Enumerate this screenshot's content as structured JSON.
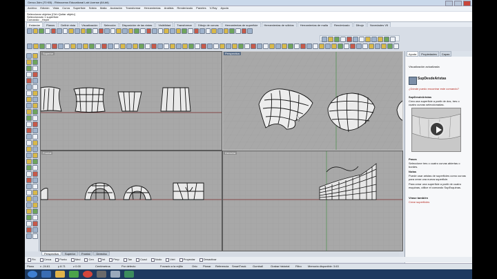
{
  "window": {
    "title": "Genco.3dm (70 KB) - Rhinoceros Educational Lab License (64-bit)"
  },
  "menu": {
    "items": [
      "Archivo",
      "Edición",
      "Vista",
      "Curva",
      "Superficie",
      "Sólido",
      "Malla",
      "Acotación",
      "Transformar",
      "Herramientas",
      "Análisis",
      "Renderizado",
      "Paneles",
      "V-Ray",
      "Ayuda"
    ]
  },
  "command": {
    "history1": "Seleccionar objetos [Ctrl=Quitar objeto]",
    "history2": "Seleccionado 1 superficie",
    "prompt": "Comando: _Hepirl"
  },
  "toolbar_tabs": [
    "Estándar",
    "Planos",
    "Definir vista",
    "Visualización",
    "Selección",
    "Disposición de las vistas",
    "Visibilidad",
    "Transformar",
    "Dibujo de curvas",
    "Herramientas de superficie",
    "Herramientas de sólidos",
    "Herramientas de malla",
    "Renderizado",
    "Dibujo",
    "Novedades V5"
  ],
  "viewports": [
    {
      "label": "Superior"
    },
    {
      "label": "Perspectiva"
    },
    {
      "label": "Frontal"
    },
    {
      "label": "Derecha"
    }
  ],
  "viewport_tabs": [
    "Perspectiva",
    "Superior",
    "Frontal",
    "Derecha"
  ],
  "osnaps": [
    "Fin",
    "Cerca",
    "Punto",
    "Med",
    "Cen",
    "Int",
    "Perp",
    "Tan",
    "Cuad",
    "Nodo",
    "Vért",
    "Proyectar",
    "Desactivar"
  ],
  "status": {
    "plane": "Plano",
    "x": "x -24.61",
    "y": "y 8.71",
    "z": "z 0.00",
    "units": "Centímetros",
    "layer": "Por defecto",
    "items": [
      "Forzado a la rejilla",
      "Orto",
      "Planar",
      "Referencia",
      "SmartTrack",
      "Gumball",
      "Grabar historial",
      "Filtro",
      "Memoria disponible: 3.63"
    ]
  },
  "panel": {
    "tabs": [
      "Ayuda",
      "Propiedades",
      "Capas"
    ],
    "section": "Visualización actualizada",
    "command_title": "SupDesdeAristas",
    "question": "¿Dónde puedo encontrar este comando?",
    "subtitle": "SupDesdeAristas",
    "description": "Crea una superficie a partir de dos, tres o cuatro curvas seleccionadas.",
    "steps_title": "Pasos",
    "step1": "Seleccione tres o cuatro curvas abiertas o bordes.",
    "notes_title": "Notas",
    "note1": "Puede usar aristas de superficies como curvas para crear una nueva superficie.",
    "note2": "Para crear una superficie a partir de cuatro esquinas, utilice el comando SupEsquinas.",
    "see_also": "Véase también",
    "link": "Crear superficies"
  }
}
